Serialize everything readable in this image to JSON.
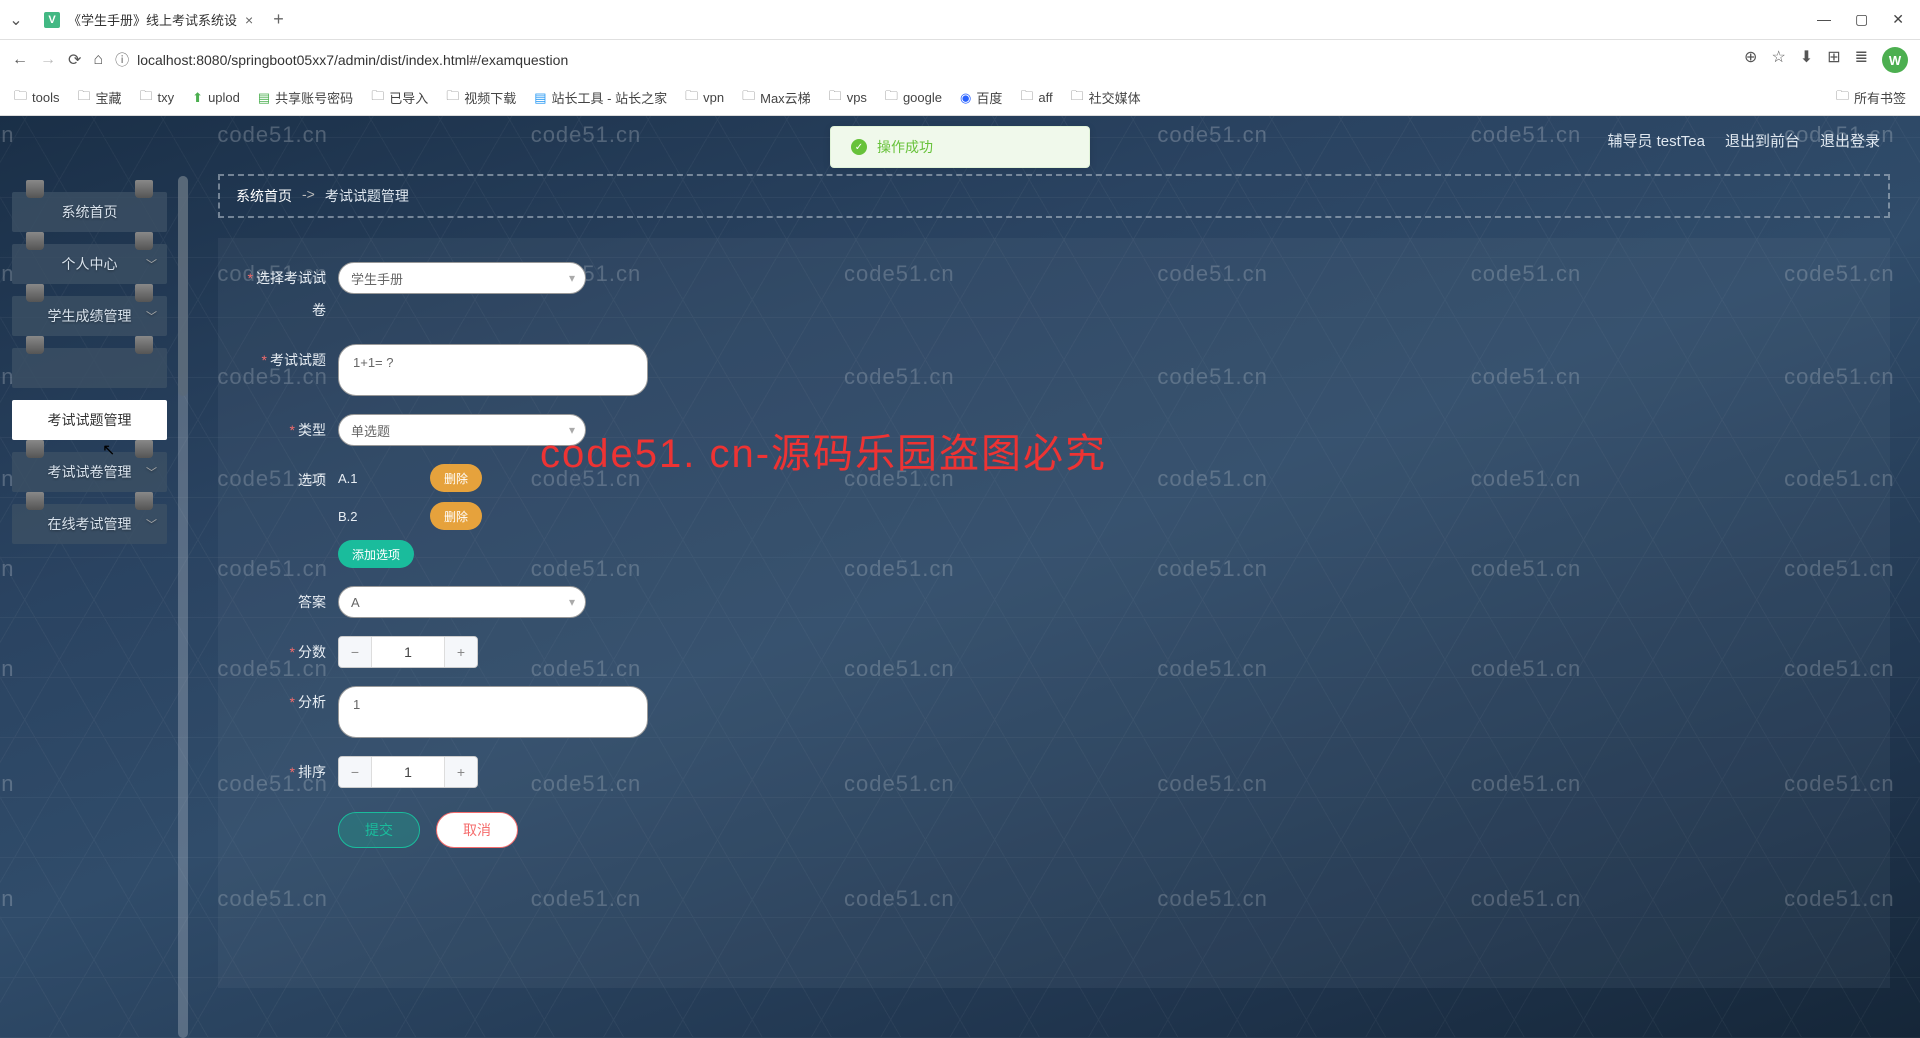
{
  "browser": {
    "tab_title": "《学生手册》线上考试系统设",
    "url": "localhost:8080/springboot05xx7/admin/dist/index.html#/examquestion",
    "bookmarks": [
      "tools",
      "宝藏",
      "txy",
      "uplod",
      "共享账号密码",
      "已导入",
      "视频下载",
      "站长工具 - 站长之家",
      "vpn",
      "Max云梯",
      "vps",
      "google",
      "百度",
      "aff",
      "社交媒体"
    ],
    "all_bookmarks": "所有书签",
    "avatar_initial": "W"
  },
  "toast": {
    "text": "操作成功"
  },
  "header": {
    "role": "辅导员 testTea",
    "front": "退出到前台",
    "logout": "退出登录"
  },
  "sidebar": {
    "items": [
      {
        "label": "系统首页",
        "expandable": false,
        "active": false
      },
      {
        "label": "个人中心",
        "expandable": true,
        "active": false
      },
      {
        "label": "学生成绩管理",
        "expandable": true,
        "active": false
      },
      {
        "label": "",
        "expandable": false,
        "active": false
      },
      {
        "label": "考试试题管理",
        "expandable": false,
        "active": true
      },
      {
        "label": "考试试卷管理",
        "expandable": true,
        "active": false
      },
      {
        "label": "在线考试管理",
        "expandable": true,
        "active": false
      }
    ]
  },
  "breadcrumb": {
    "home": "系统首页",
    "current": "考试试题管理",
    "sep": "->"
  },
  "form": {
    "labels": {
      "paper": "选择考试试卷",
      "question": "考试试题",
      "type": "类型",
      "options": "选项",
      "answer": "答案",
      "score": "分数",
      "analysis": "分析",
      "order": "排序"
    },
    "values": {
      "paper": "学生手册",
      "question": "1+1= ?",
      "type": "单选题",
      "answer": "A",
      "score": "1",
      "analysis": "1",
      "order": "1"
    },
    "options": [
      {
        "text": "A.1"
      },
      {
        "text": "B.2"
      }
    ],
    "buttons": {
      "delete": "删除",
      "addOption": "添加选项",
      "submit": "提交",
      "cancel": "取消"
    }
  },
  "watermark_text": "code51.cn",
  "watermark_red": "code51. cn-源码乐园盗图必究"
}
